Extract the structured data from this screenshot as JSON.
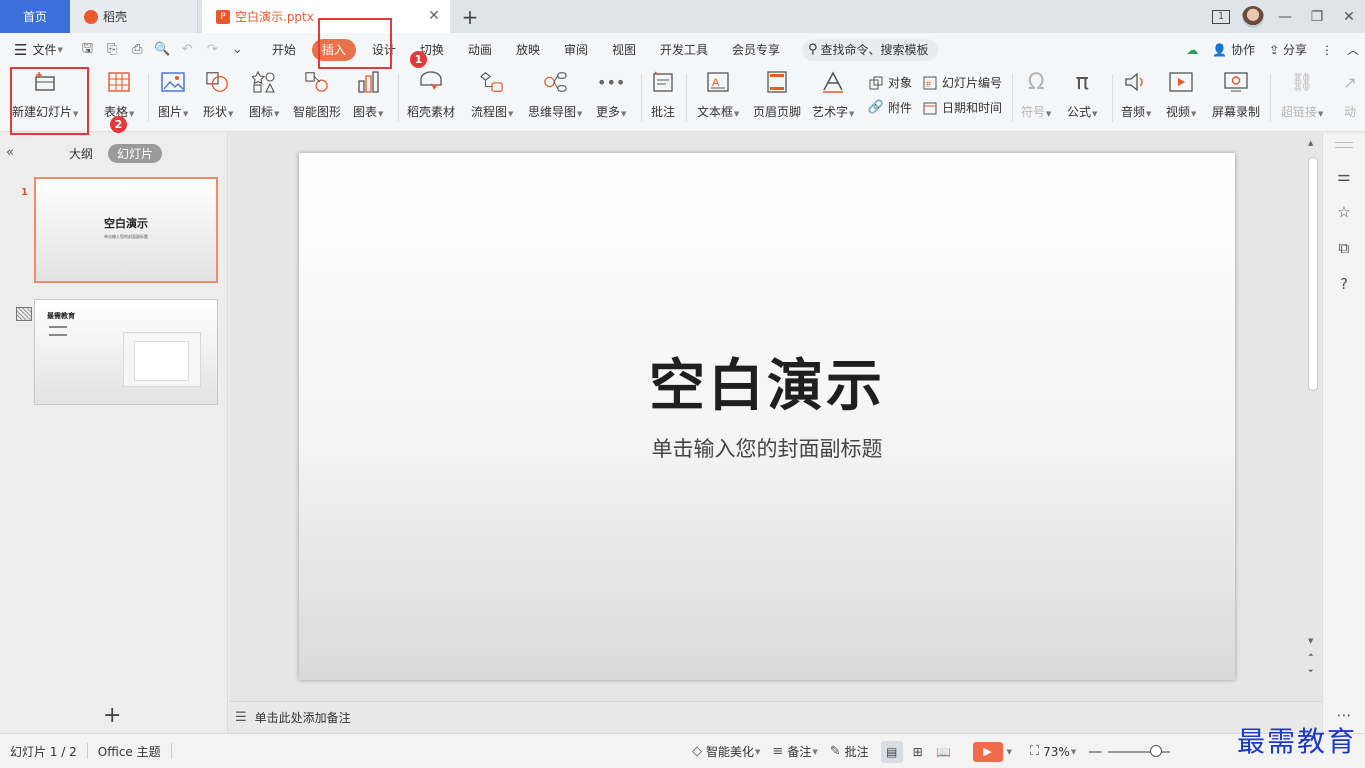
{
  "tabs": {
    "home": "首页",
    "daoke": "稻壳",
    "doc": "空白演示.pptx"
  },
  "window": {
    "badge": "1"
  },
  "menu": {
    "file": "文件",
    "tabs": [
      "开始",
      "插入",
      "设计",
      "切换",
      "动画",
      "放映",
      "审阅",
      "视图",
      "开发工具",
      "会员专享"
    ],
    "active_tab": "插入",
    "search_placeholder": "查找命令、搜索模板",
    "collab": "协作",
    "share": "分享"
  },
  "ribbon": {
    "new_slide": "新建幻灯片",
    "table": "表格",
    "picture": "图片",
    "shape": "形状",
    "icon": "图标",
    "smart_graphic": "智能图形",
    "chart": "图表",
    "daoke_material": "稻壳素材",
    "flowchart": "流程图",
    "mindmap": "思维导图",
    "more": "更多",
    "comment": "批注",
    "textbox": "文本框",
    "header_footer": "页眉页脚",
    "wordart": "艺术字",
    "object": "对象",
    "attachment": "附件",
    "slide_number": "幻灯片编号",
    "date_time": "日期和时间",
    "symbol": "符号",
    "formula": "公式",
    "audio": "音频",
    "video": "视频",
    "screen_record": "屏幕录制",
    "hyperlink": "超链接",
    "animation": "动"
  },
  "left_panel": {
    "outline": "大纲",
    "slides": "幻灯片",
    "slide1_number": "1",
    "slide1_title": "空白演示",
    "slide1_subtitle": "单击输入您的封面副标题",
    "slide2_title": "最需教育"
  },
  "slide": {
    "title": "空白演示",
    "subtitle": "单击输入您的封面副标题"
  },
  "notes_placeholder": "单击此处添加备注",
  "status": {
    "slide_count": "幻灯片 1 / 2",
    "theme": "Office 主题",
    "beautify": "智能美化",
    "notes": "备注",
    "comments": "批注",
    "zoom": "73%"
  },
  "annotations": {
    "step1": "1",
    "step2": "2"
  },
  "watermark": "最需教育",
  "colors": {
    "accent": "#e8734a",
    "highlight": "#e23a3a",
    "home_tab": "#3c6fd8",
    "watermark": "#1b39c9"
  }
}
